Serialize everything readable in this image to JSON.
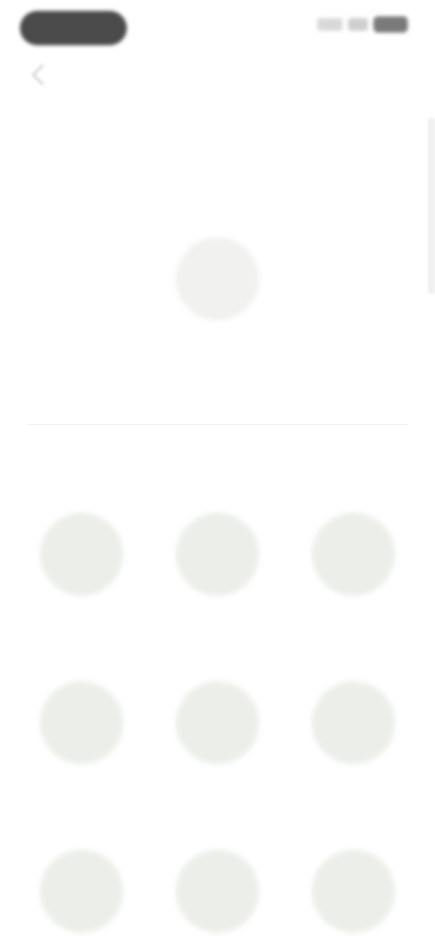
{
  "status_bar": {
    "time": "",
    "icons": [
      "signal-icon",
      "wifi-icon",
      "battery-icon"
    ]
  },
  "header": {
    "back_icon": "back-chevron-icon",
    "link_text": ""
  },
  "section_one": {
    "title": "",
    "profile_name": ""
  },
  "section_two": {
    "title": "",
    "items": [
      {
        "label": ""
      },
      {
        "label": ""
      },
      {
        "label": ""
      },
      {
        "label": ""
      },
      {
        "label": ""
      },
      {
        "label": ""
      },
      {
        "label": ""
      },
      {
        "label": ""
      },
      {
        "label": ""
      }
    ]
  },
  "colors": {
    "accent": "#5a66d8",
    "circle": "#ecefe9",
    "text_muted": "#a8a8a8"
  }
}
